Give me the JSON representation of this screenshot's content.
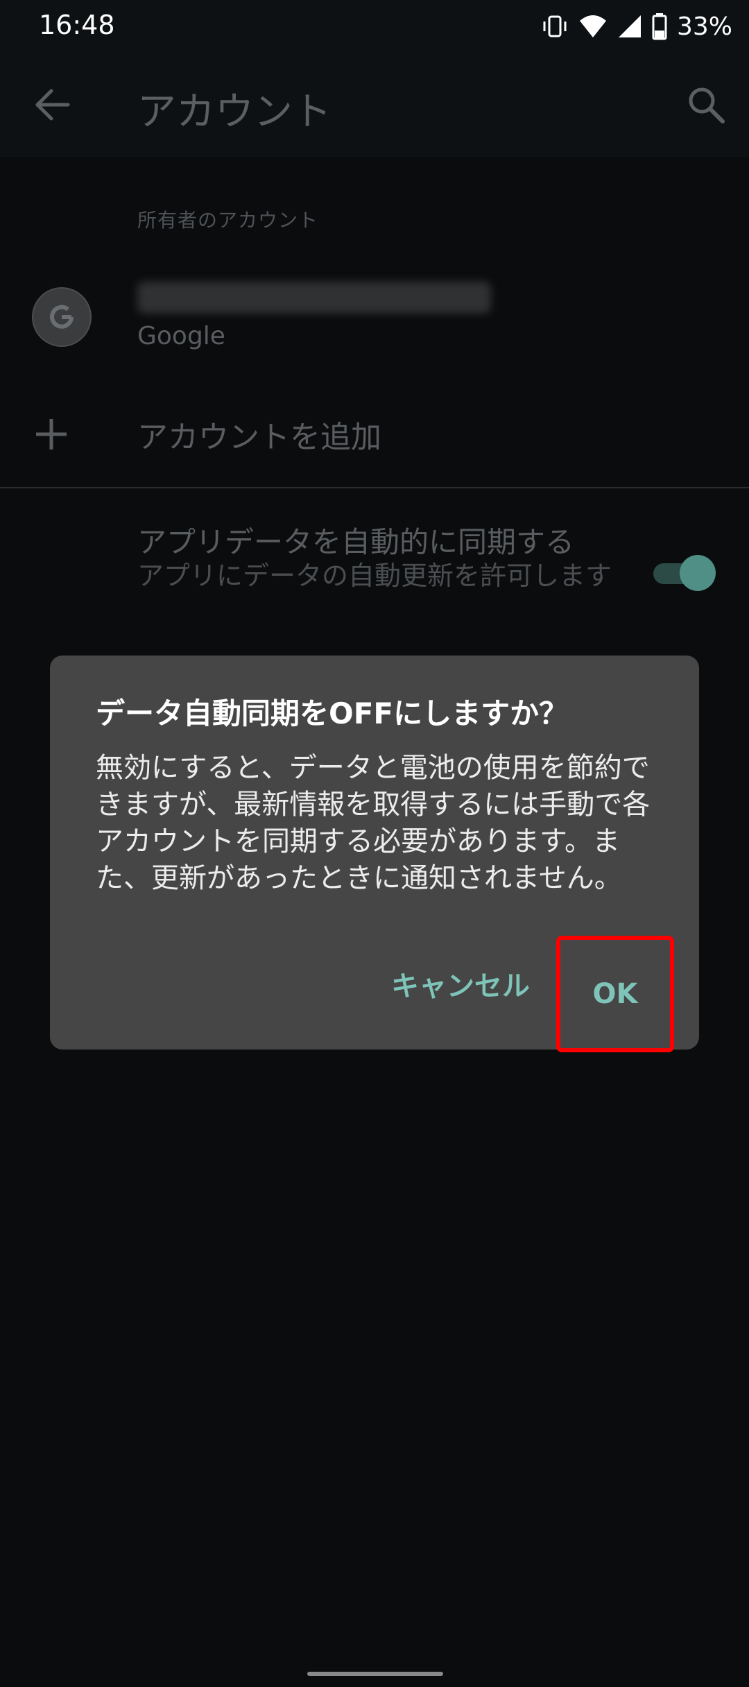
{
  "status_bar": {
    "time": "16:48",
    "battery_text": "33%",
    "icons": [
      "vibrate-icon",
      "wifi-icon",
      "signal-icon",
      "battery-icon"
    ]
  },
  "app_bar": {
    "title": "アカウント",
    "back_icon": "arrow-left-icon",
    "search_icon": "search-icon"
  },
  "accounts": {
    "section_label": "所有者のアカウント",
    "account_type": "Google",
    "add_account_label": "アカウントを追加"
  },
  "sync": {
    "title": "アプリデータを自動的に同期する",
    "subtitle": "アプリにデータの自動更新を許可します",
    "toggle_on": true
  },
  "dialog": {
    "title": "データ自動同期をOFFにしますか？",
    "body": "無効にすると、データと電池の使用を節約できますが、最新情報を取得するには手動で各アカウントを同期する必要があります。また、更新があったときに通知されません。",
    "cancel_label": "キャンセル",
    "ok_label": "OK"
  },
  "colors": {
    "accent": "#7fc4b9",
    "highlight": "#ff0000",
    "dialog_bg": "#464646"
  }
}
